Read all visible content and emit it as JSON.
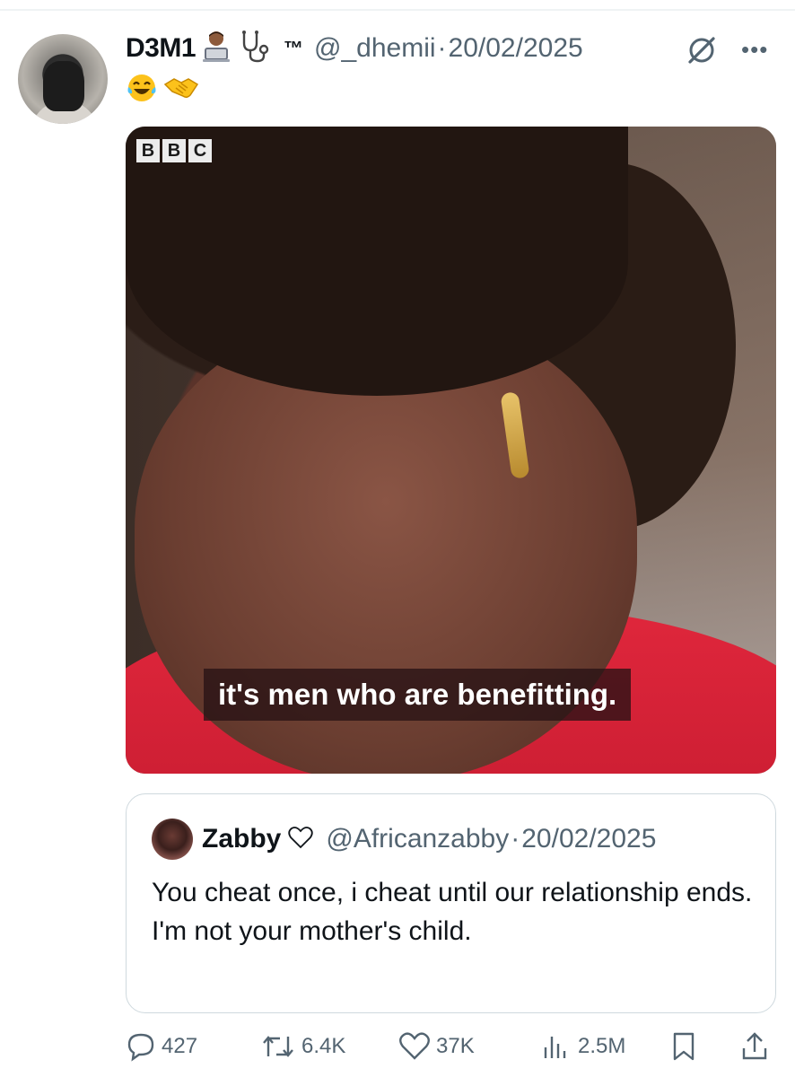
{
  "tweet": {
    "author": {
      "display_name": "D3M1",
      "tm": "™",
      "handle": "@_dhemii",
      "emoji_row": [
        "😂",
        "🤝"
      ]
    },
    "separator": "·",
    "date": "20/02/2025",
    "more_label": "•••",
    "media": {
      "watermark": [
        "B",
        "B",
        "C"
      ],
      "caption": "it's men who are benefitting."
    },
    "quoted": {
      "display_name": "Zabby",
      "handle": "@Africanzabby",
      "separator": "·",
      "date": "20/02/2025",
      "text": "You cheat once, i cheat until our relationship ends. I'm not your mother's child."
    },
    "actions": {
      "replies": "427",
      "reposts": "6.4K",
      "likes": "37K",
      "views": "2.5M"
    }
  }
}
